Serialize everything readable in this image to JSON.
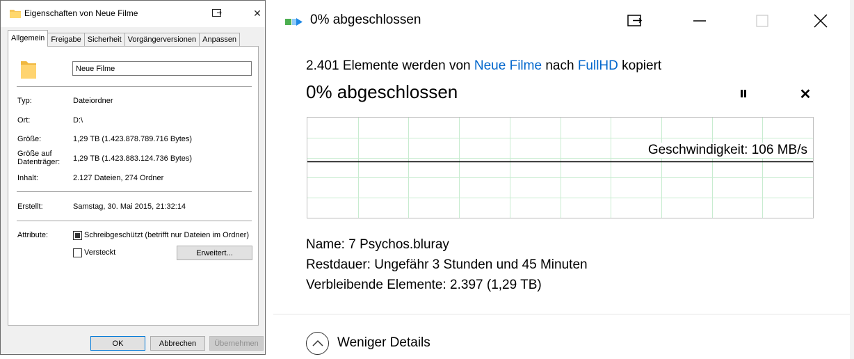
{
  "properties_dialog": {
    "title": "Eigenschaften von Neue Filme",
    "tabs": [
      "Allgemein",
      "Freigabe",
      "Sicherheit",
      "Vorgängerversionen",
      "Anpassen"
    ],
    "active_tab": "Allgemein",
    "folder_name": "Neue Filme",
    "rows": {
      "type": {
        "label": "Typ:",
        "value": "Dateiordner"
      },
      "location": {
        "label": "Ort:",
        "value": "D:\\"
      },
      "size": {
        "label": "Größe:",
        "value": "1,29 TB (1.423.878.789.716 Bytes)"
      },
      "size_on_disk": {
        "label": "Größe auf Datenträger:",
        "value": "1,29 TB (1.423.883.124.736 Bytes)"
      },
      "contents": {
        "label": "Inhalt:",
        "value": "2.127 Dateien, 274 Ordner"
      },
      "created": {
        "label": "Erstellt:",
        "value": "Samstag, 30. Mai 2015, 21:32:14"
      }
    },
    "attributes": {
      "label": "Attribute:",
      "readonly": {
        "label": "Schreibgeschützt (betrifft nur Dateien im Ordner)",
        "state": "indeterminate"
      },
      "hidden": {
        "label": "Versteckt",
        "state": "unchecked"
      },
      "advanced_button": "Erweitert..."
    },
    "buttons": {
      "ok": "OK",
      "cancel": "Abbrechen",
      "apply": "Übernehmen"
    }
  },
  "copy_dialog": {
    "window_title": "0% abgeschlossen",
    "summary": {
      "prefix": "2.401 Elemente werden von",
      "source": "Neue Filme",
      "middle": "nach",
      "destination": "FullHD",
      "suffix": "kopiert"
    },
    "progress_title": "0% abgeschlossen",
    "progress_percent": 0,
    "speed": "Geschwindigkeit: 106 MB/s",
    "details": {
      "name": {
        "label": "Name:",
        "value": "7 Psychos.bluray"
      },
      "remaining_time": {
        "label": "Restdauer:",
        "value": "Ungefähr 3 Stunden und 45 Minuten"
      },
      "remaining_items": {
        "label": "Verbleibende Elemente:",
        "value": "2.397 (1,29 TB)"
      }
    },
    "less_details": "Weniger Details"
  },
  "colors": {
    "link": "#0066cc",
    "graph_grid": "#c8ecd0",
    "folder": "#f5c65a",
    "primary_border": "#0078d7"
  }
}
